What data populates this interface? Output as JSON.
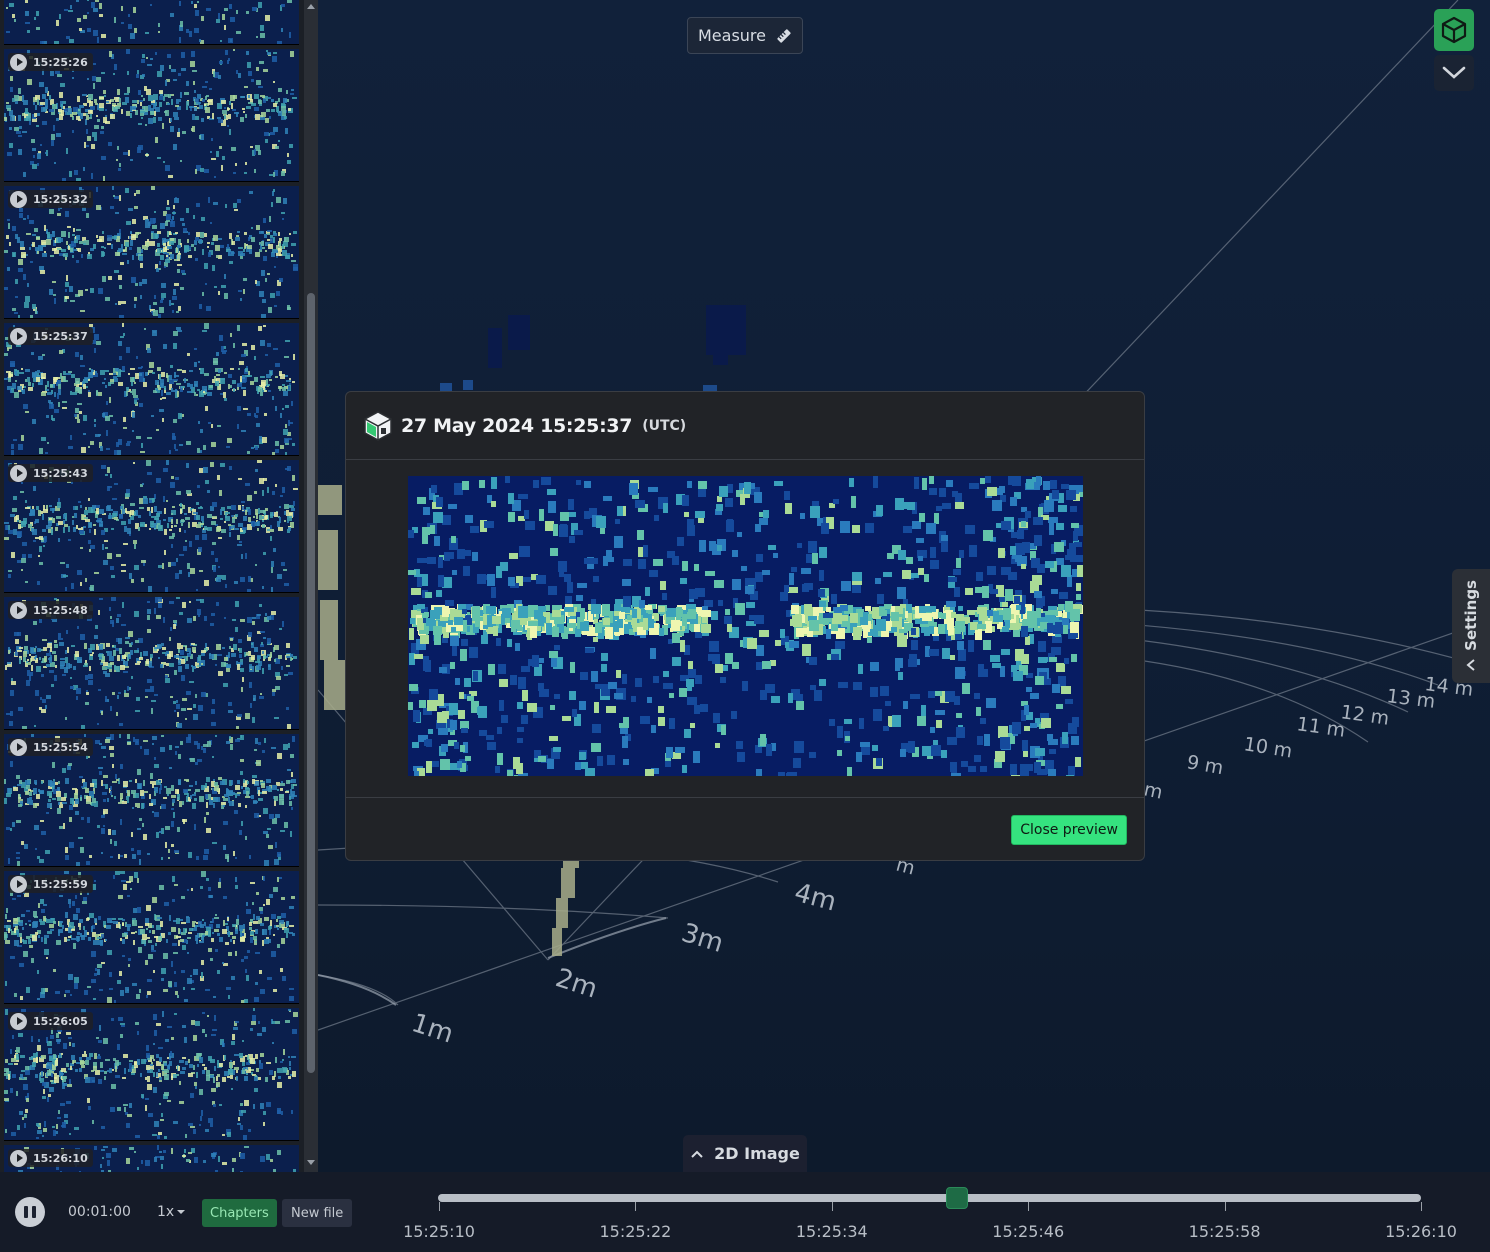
{
  "sidebar": {
    "thumbnails": [
      {
        "time": ""
      },
      {
        "time": "15:25:26"
      },
      {
        "time": "15:25:32"
      },
      {
        "time": "15:25:37"
      },
      {
        "time": "15:25:43"
      },
      {
        "time": "15:25:48"
      },
      {
        "time": "15:25:54"
      },
      {
        "time": "15:25:59"
      },
      {
        "time": "15:26:05"
      },
      {
        "time": "15:26:10"
      }
    ]
  },
  "toolbar": {
    "measure_label": "Measure"
  },
  "settings": {
    "label": "Settings"
  },
  "scene": {
    "distance_labels": [
      "1m",
      "2m",
      "3m",
      "4m",
      "9 m",
      "10 m",
      "11 m",
      "12 m",
      "13 m",
      "14 m",
      "m",
      "m"
    ]
  },
  "preview": {
    "title": "27 May 2024 15:25:37",
    "timezone": "(UTC)",
    "close_label": "Close preview"
  },
  "image_toggle": {
    "label": "2D Image"
  },
  "player": {
    "elapsed": "00:01:00",
    "speed": "1x",
    "chapters_label": "Chapters",
    "new_file_label": "New file",
    "position_fraction": 0.528,
    "ticks": [
      "15:25:10",
      "15:25:22",
      "15:25:34",
      "15:25:46",
      "15:25:58",
      "15:26:10"
    ]
  },
  "colors": {
    "accent_green": "#35e37f",
    "heatmap_bg": "#071c63"
  }
}
